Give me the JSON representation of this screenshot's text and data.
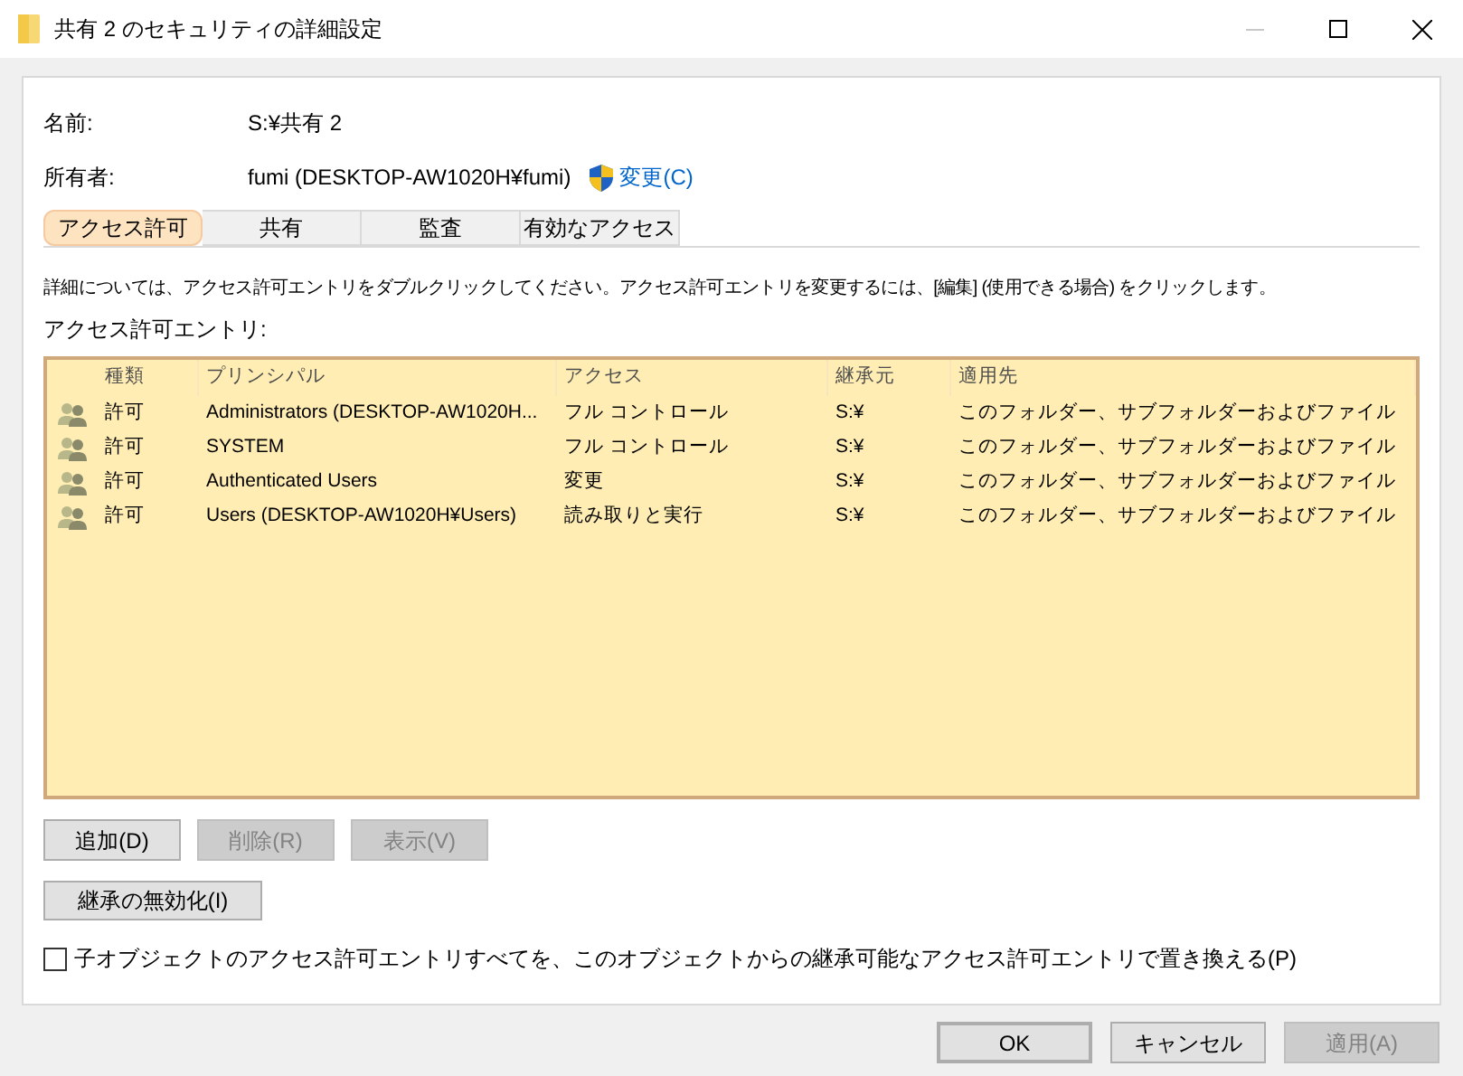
{
  "window": {
    "title": "共有 2 のセキュリティの詳細設定",
    "minimize_disabled": true
  },
  "fields": [
    {
      "label": "名前:",
      "value": "S:¥共有 2"
    },
    {
      "label": "所有者:",
      "value": "fumi (DESKTOP-AW1020H¥fumi)",
      "link": "変更(C)"
    }
  ],
  "tabs": [
    {
      "label": "アクセス許可",
      "selected": true
    },
    {
      "label": "共有",
      "selected": false
    },
    {
      "label": "監査",
      "selected": false
    },
    {
      "label": "有効なアクセス",
      "selected": false
    }
  ],
  "description": "詳細については、アクセス許可エントリをダブルクリックしてください。アクセス許可エントリを変更するには、[編集] (使用できる場合) をクリックします。",
  "list_label": "アクセス許可エントリ:",
  "table": {
    "columns": [
      "種類",
      "プリンシパル",
      "アクセス",
      "継承元",
      "適用先"
    ],
    "rows": [
      [
        "許可",
        "Administrators (DESKTOP-AW1020H...",
        "フル コントロール",
        "S:¥",
        "このフォルダー、サブフォルダーおよびファイル"
      ],
      [
        "許可",
        "SYSTEM",
        "フル コントロール",
        "S:¥",
        "このフォルダー、サブフォルダーおよびファイル"
      ],
      [
        "許可",
        "Authenticated Users",
        "変更",
        "S:¥",
        "このフォルダー、サブフォルダーおよびファイル"
      ],
      [
        "許可",
        "Users (DESKTOP-AW1020H¥Users)",
        "読み取りと実行",
        "S:¥",
        "このフォルダー、サブフォルダーおよびファイル"
      ]
    ]
  },
  "entry_buttons": [
    {
      "label": "追加(D)",
      "disabled": false
    },
    {
      "label": "削除(R)",
      "disabled": true
    },
    {
      "label": "表示(V)",
      "disabled": true
    }
  ],
  "inheritance_button": "継承の無効化(I)",
  "replace_checkbox": {
    "label": "子オブジェクトのアクセス許可エントリすべてを、このオブジェクトからの継承可能なアクセス許可エントリで置き換える(P)",
    "checked": false
  },
  "footer_buttons": [
    {
      "label": "OK",
      "default": true,
      "disabled": false
    },
    {
      "label": "キャンセル",
      "default": false,
      "disabled": false
    },
    {
      "label": "適用(A)",
      "default": false,
      "disabled": true
    }
  ]
}
